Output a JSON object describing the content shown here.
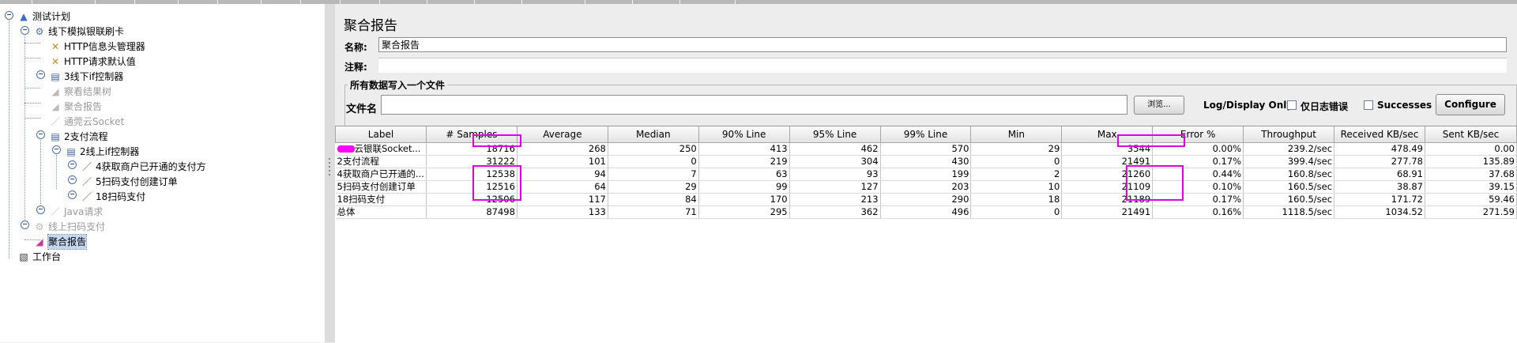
{
  "tree": {
    "items": [
      {
        "label": "测试计划",
        "icon": "test-plan-flask-icon",
        "disabled": false,
        "selected": false
      },
      {
        "label": "线下模拟银联刷卡",
        "icon": "thread-group-gear-icon",
        "disabled": false,
        "selected": false
      },
      {
        "label": "HTTP信息头管理器",
        "icon": "config-tools-icon",
        "disabled": false,
        "selected": false
      },
      {
        "label": "HTTP请求默认值",
        "icon": "config-tools-icon",
        "disabled": false,
        "selected": false
      },
      {
        "label": "3线下if控制器",
        "icon": "controller-icon",
        "disabled": false,
        "selected": false
      },
      {
        "label": "察看结果树",
        "icon": "listener-chart-icon",
        "disabled": true,
        "selected": false
      },
      {
        "label": "聚合报告",
        "icon": "listener-chart-icon",
        "disabled": true,
        "selected": false
      },
      {
        "label": "通莞云Socket",
        "icon": "sampler-pipette-icon",
        "disabled": true,
        "selected": false
      },
      {
        "label": "2支付流程",
        "icon": "controller-icon",
        "disabled": false,
        "selected": false
      },
      {
        "label": "2线上if控制器",
        "icon": "controller-icon",
        "disabled": false,
        "selected": false
      },
      {
        "label": "4获取商户已开通的支付方",
        "icon": "sampler-pipette-icon",
        "disabled": false,
        "selected": false
      },
      {
        "label": "5扫码支付创建订单",
        "icon": "sampler-pipette-icon",
        "disabled": false,
        "selected": false
      },
      {
        "label": "18扫码支付",
        "icon": "sampler-pipette-icon",
        "disabled": false,
        "selected": false
      },
      {
        "label": "Java请求",
        "icon": "sampler-pipette-icon",
        "disabled": true,
        "selected": false
      },
      {
        "label": "线上扫码支付",
        "icon": "thread-group-gear-icon",
        "disabled": true,
        "selected": false
      },
      {
        "label": "聚合报告",
        "icon": "listener-chart-icon",
        "disabled": false,
        "selected": true
      },
      {
        "label": "工作台",
        "icon": "workbench-icon",
        "disabled": false,
        "selected": false
      }
    ]
  },
  "panel": {
    "title": "聚合报告",
    "name_label": "名称:",
    "name_value": "聚合报告",
    "comment_label": "注释:",
    "comment_value": "",
    "file_group_title": "所有数据写入一个文件",
    "filename_label": "文件名",
    "filename_value": "",
    "browse_label": "浏览...",
    "log_display_label": "Log/Display Only:",
    "errors_only_label": "仅日志错误",
    "successes_label": "Successes",
    "configure_label": "Configure"
  },
  "table": {
    "columns": [
      "Label",
      "# Samples",
      "Average",
      "Median",
      "90% Line",
      "95% Line",
      "99% Line",
      "Min",
      "Max",
      "Error %",
      "Throughput",
      "Received KB/sec",
      "Sent KB/sec"
    ],
    "rows": [
      [
        "云银联Socket...",
        "18716",
        "268",
        "250",
        "413",
        "462",
        "570",
        "29",
        "3544",
        "0.00%",
        "239.2/sec",
        "478.49",
        "0.00"
      ],
      [
        "2支付流程",
        "31222",
        "101",
        "0",
        "219",
        "304",
        "430",
        "0",
        "21491",
        "0.17%",
        "399.4/sec",
        "277.78",
        "135.89"
      ],
      [
        "4获取商户已开通的...",
        "12538",
        "94",
        "7",
        "63",
        "93",
        "199",
        "2",
        "21260",
        "0.44%",
        "160.8/sec",
        "68.91",
        "37.68"
      ],
      [
        "5扫码支付创建订单",
        "12516",
        "64",
        "29",
        "99",
        "127",
        "203",
        "10",
        "21109",
        "0.10%",
        "160.5/sec",
        "38.87",
        "39.15"
      ],
      [
        "18扫码支付",
        "12506",
        "117",
        "84",
        "170",
        "213",
        "290",
        "18",
        "21189",
        "0.17%",
        "160.5/sec",
        "171.72",
        "59.46"
      ],
      [
        "总体",
        "87498",
        "133",
        "71",
        "295",
        "362",
        "496",
        "0",
        "21491",
        "0.16%",
        "1118.5/sec",
        "1034.52",
        "271.59"
      ]
    ]
  },
  "colors": {
    "highlight": "#e000e0",
    "selection": "#c5d7ee",
    "disabled_text": "#9a9a9a"
  }
}
